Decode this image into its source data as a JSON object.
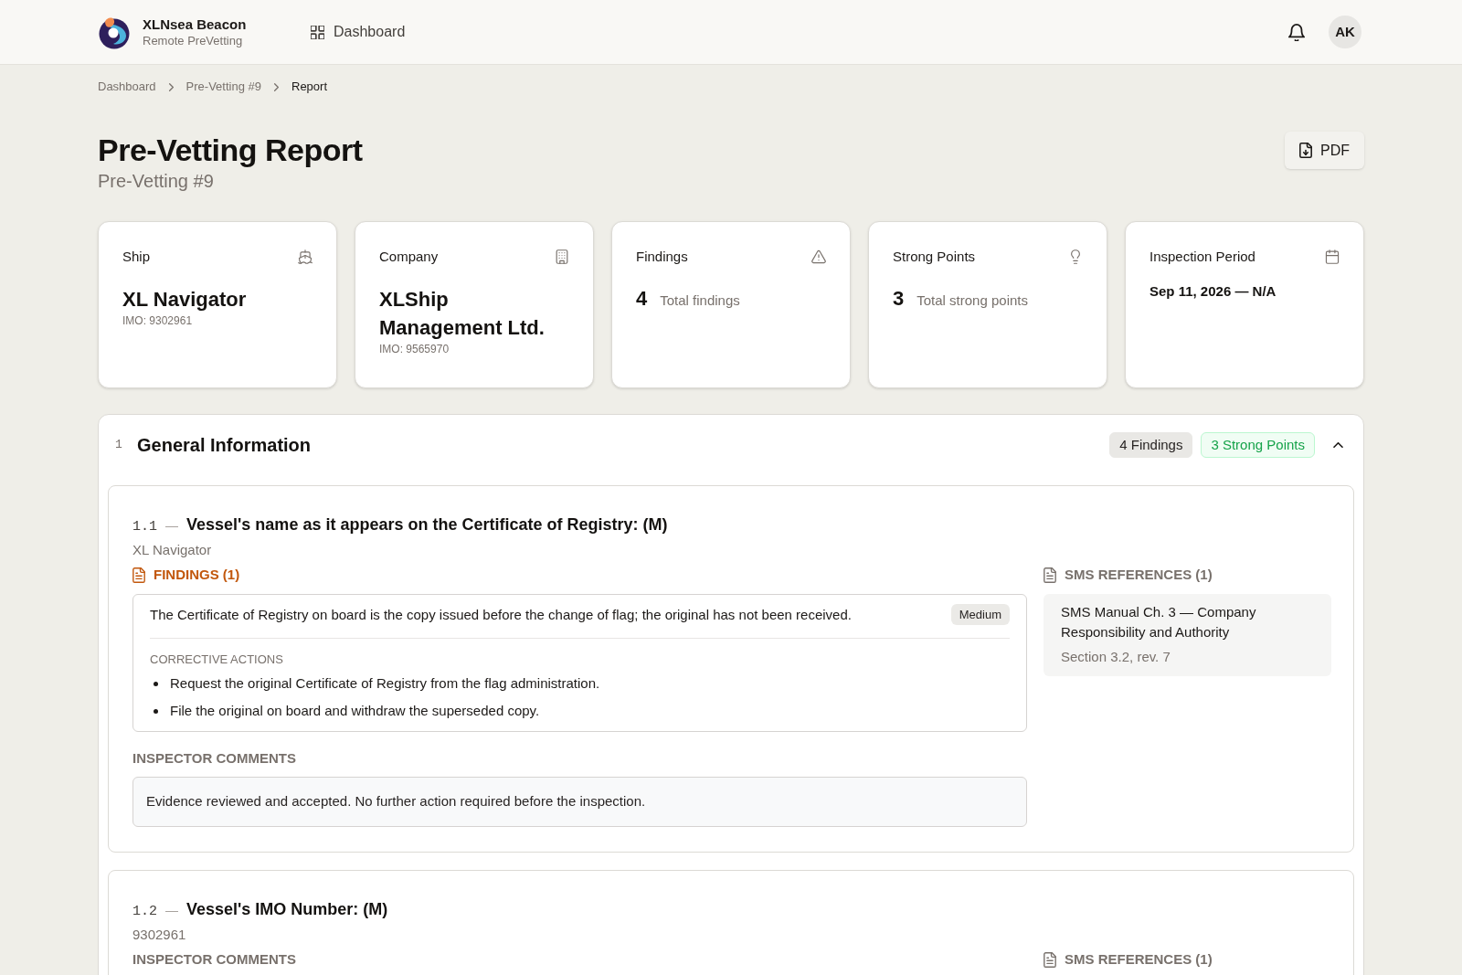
{
  "header": {
    "brand": {
      "name": "XLNsea Beacon",
      "tagline": "Remote PreVetting"
    },
    "nav": [
      {
        "label": "Dashboard",
        "selected": false
      }
    ],
    "avatar": "AK"
  },
  "breadcrumb": [
    {
      "label": "Dashboard",
      "current": false
    },
    {
      "label": "Pre-Vetting #9",
      "current": false
    },
    {
      "label": "Report",
      "current": true
    }
  ],
  "page": {
    "title": "Pre-Vetting Report",
    "subtitle": "Pre-Vetting #9",
    "actions": [
      {
        "label": "PDF"
      }
    ]
  },
  "summary_cards": [
    {
      "kind": "ship",
      "label": "Ship",
      "value": "XL Navigator",
      "detail": "IMO: 9302961"
    },
    {
      "kind": "company",
      "label": "Company",
      "value": "XLShip Management Ltd.",
      "detail": "IMO: 9565970"
    },
    {
      "kind": "findings",
      "label": "Findings",
      "value": "4",
      "detail": "Total findings"
    },
    {
      "kind": "strengths",
      "label": "Strong Points",
      "value": "3",
      "detail": "Total strong points"
    },
    {
      "kind": "period",
      "label": "Inspection Period",
      "value": "Sep 11, 2026 — N/A"
    }
  ],
  "sections": [
    {
      "number": "1",
      "title": "General Information",
      "expanded": true,
      "badges": [
        {
          "kind": "findings",
          "label": "4 Findings"
        },
        {
          "kind": "strengths",
          "label": "3 Strong Points"
        }
      ],
      "questions": [
        {
          "number": "1.1",
          "dash": "—",
          "title": "Vessel's name as it appears on the Certificate of Registry: (M)",
          "answer": "XL Navigator",
          "findings_label": "FINDINGS (1)",
          "findings": [
            {
              "text": "The Certificate of Registry on board is the copy issued before the change of flag; the original has not been received.",
              "severity": "Medium",
              "corrective_label": "CORRECTIVE ACTIONS",
              "actions": [
                "Request the original Certificate of Registry from the flag administration.",
                "File the original on board and withdraw the superseded copy."
              ]
            }
          ],
          "comments_label": "INSPECTOR COMMENTS",
          "comment": "Evidence reviewed and accepted. No further action required before the inspection.",
          "sms_label": "SMS REFERENCES (1)",
          "sms_refs": [
            {
              "title": "SMS Manual Ch. 3 — Company Responsibility and Authority",
              "detail": "Section 3.2, rev. 7"
            }
          ]
        },
        {
          "number": "1.2",
          "dash": "—",
          "title": "Vessel's IMO Number: (M)",
          "answer": "9302961",
          "comments_label": "INSPECTOR COMMENTS",
          "sms_label": "SMS REFERENCES (1)"
        }
      ]
    }
  ]
}
